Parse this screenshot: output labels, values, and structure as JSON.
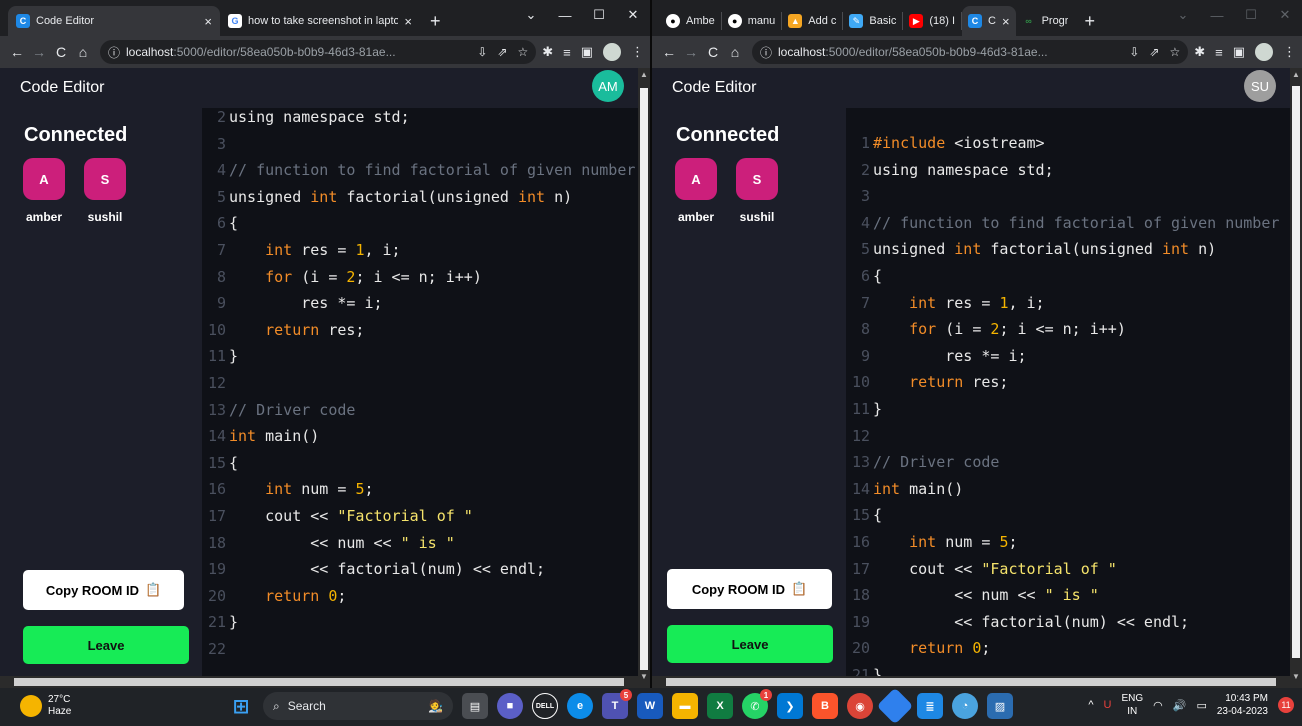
{
  "taskbar": {
    "weather_temp": "27°C",
    "weather_desc": "Haze",
    "search_label": "Search",
    "lang_line1": "ENG",
    "lang_line2": "IN",
    "time": "10:43 PM",
    "date": "23-04-2023",
    "notification_count": "11",
    "teams_badge": "5",
    "whatsapp_badge": "1"
  },
  "left": {
    "tabs": [
      {
        "label": "Code Editor",
        "close": "×"
      },
      {
        "label": "how to take screenshot in laptop",
        "close": "×"
      }
    ],
    "newtab": "+",
    "url_host": "localhost",
    "url_path": ":5000/editor/58ea050b-b0b9-46d3-81ae...",
    "app_title": "Code Editor",
    "user_avatar": "AM",
    "connected_heading": "Connected",
    "clients": [
      {
        "initial": "A",
        "name": "amber"
      },
      {
        "initial": "S",
        "name": "sushil"
      }
    ],
    "copy_button": "Copy ROOM ID",
    "leave_button": "Leave"
  },
  "right": {
    "tabs": [
      {
        "label": "Ambe"
      },
      {
        "label": "manu"
      },
      {
        "label": "Add c"
      },
      {
        "label": "Basic"
      },
      {
        "label": "(18) I"
      },
      {
        "label": "C",
        "close": "×"
      },
      {
        "label": "Progr"
      }
    ],
    "newtab": "+",
    "url_host": "localhost",
    "url_path": ":5000/editor/58ea050b-b0b9-46d3-81ae...",
    "app_title": "Code Editor",
    "user_avatar": "SU",
    "connected_heading": "Connected",
    "clients": [
      {
        "initial": "A",
        "name": "amber"
      },
      {
        "initial": "S",
        "name": "sushil"
      }
    ],
    "copy_button": "Copy ROOM ID",
    "leave_button": "Leave"
  },
  "code_lines": [
    "#include <iostream>",
    "using namespace std;",
    "",
    "// function to find factorial of given number",
    "unsigned int factorial(unsigned int n)",
    "{",
    "    int res = 1, i;",
    "    for (i = 2; i <= n; i++)",
    "        res *= i;",
    "    return res;",
    "}",
    "",
    "// Driver code",
    "int main()",
    "{",
    "    int num = 5;",
    "    cout << \"Factorial of \"",
    "         << num << \" is \"",
    "         << factorial(num) << endl;",
    "    return 0;",
    "}",
    ""
  ],
  "icons": {
    "back": "back-arrow-icon",
    "forward": "forward-arrow-icon",
    "reload": "reload-icon",
    "home": "home-icon",
    "clipboard": "clipboard-icon"
  },
  "colors": {
    "accent_green": "#17eb56",
    "client_avatar": "#cc1f7b",
    "user_avatar_left": "#1abc9c",
    "user_avatar_right": "#9e9e9e"
  }
}
